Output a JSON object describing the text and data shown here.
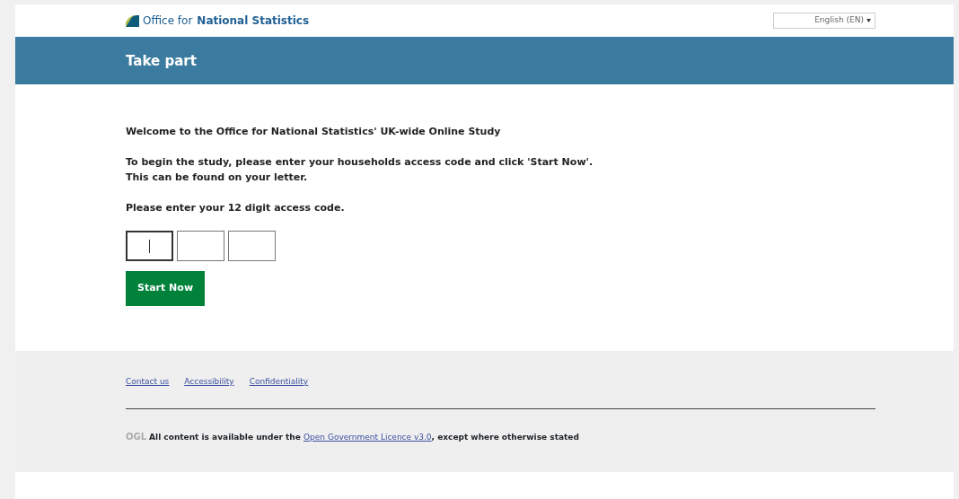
{
  "header": {
    "logo_text_light": "Office for",
    "logo_text_bold": "National Statistics",
    "language": "English (EN)"
  },
  "banner": {
    "title": "Take part"
  },
  "intro": [
    "Welcome to the Office for National Statistics' UK-wide Online Study",
    "To begin the study, please enter your households access code and click 'Start Now'.\nThis can be found on your letter.",
    "Please enter your 12 digit access code."
  ],
  "code_fields": [
    {
      "focused": true
    },
    {
      "focused": false
    },
    {
      "focused": false
    }
  ],
  "start_button": "Start Now",
  "footer": {
    "links": [
      "Contact us",
      "Accessibility",
      "Confidentiality"
    ],
    "ogl_logo": "OGL",
    "licence_before": "All content is available under the",
    "licence_link": "Open Government Licence v3.0",
    "licence_after": ", except where otherwise stated"
  }
}
